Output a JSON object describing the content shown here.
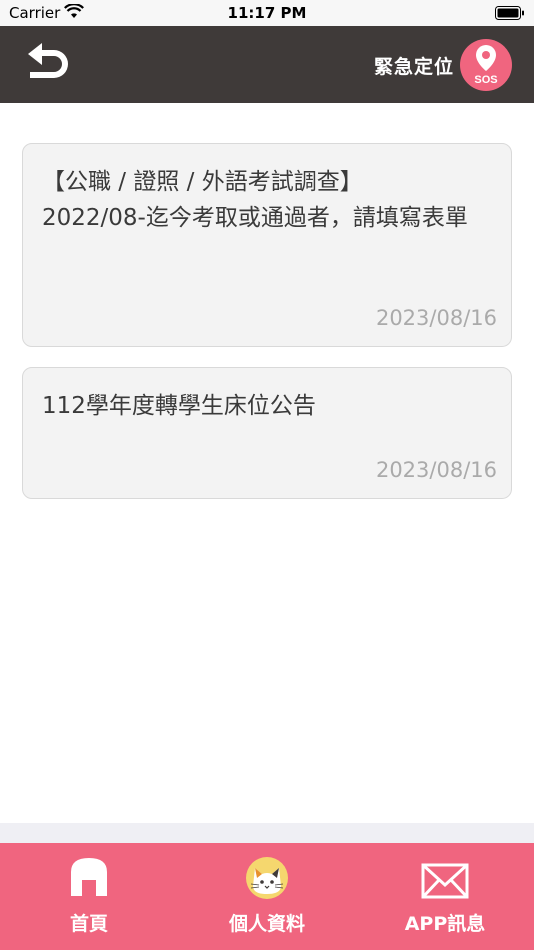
{
  "status_bar": {
    "carrier": "Carrier",
    "time": "11:17 PM"
  },
  "header": {
    "back_icon": "undo-arrow-icon",
    "sos_label": "緊急定位",
    "sos_badge_text": "SOS"
  },
  "announcements": [
    {
      "title": "【公職 / 證照 / 外語考試調查】\n2022/08-迄今考取或通過者，請填寫表單",
      "date": "2023/08/16"
    },
    {
      "title": "112學年度轉學生床位公告",
      "date": "2023/08/16"
    }
  ],
  "tab_bar": {
    "items": [
      {
        "label": "首頁",
        "icon": "home-icon"
      },
      {
        "label": "個人資料",
        "icon": "cat-avatar-icon"
      },
      {
        "label": "APP訊息",
        "icon": "mail-icon"
      }
    ]
  },
  "colors": {
    "header_bg": "#3f3a39",
    "accent_pink": "#f0657f",
    "card_bg": "#f3f3f3",
    "date_text": "#aaaaaa"
  }
}
